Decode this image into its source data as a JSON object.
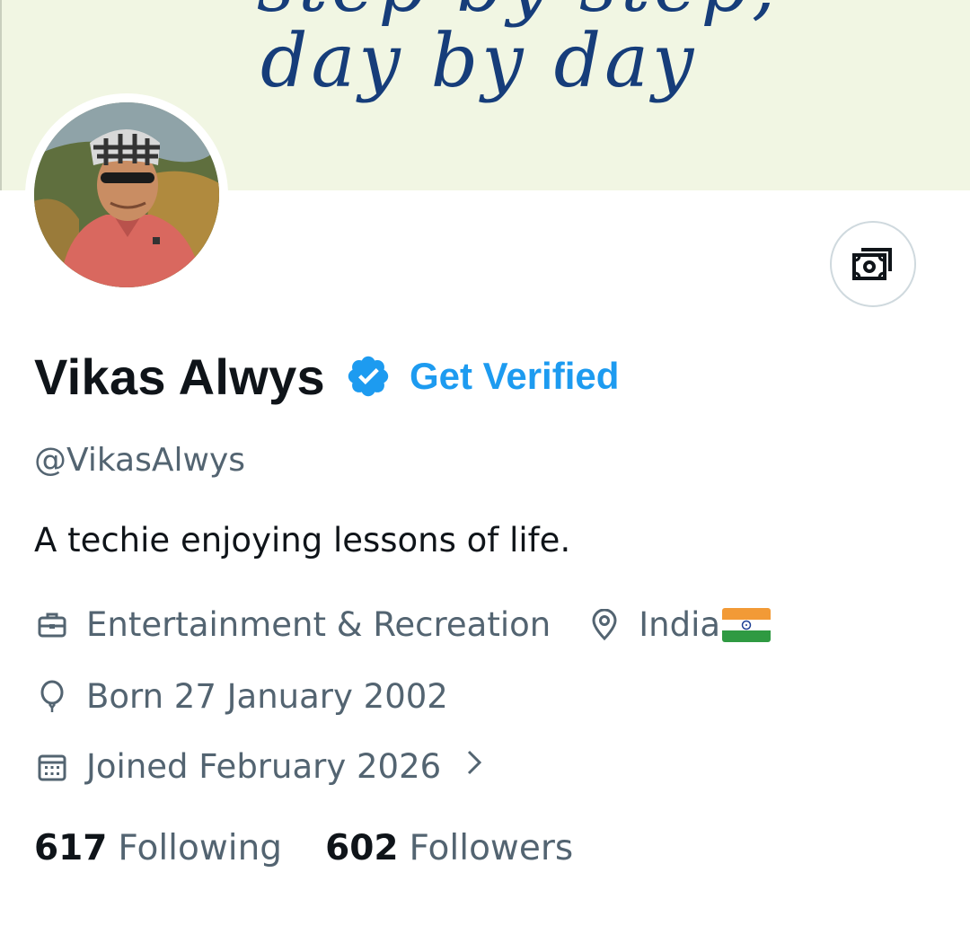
{
  "banner": {
    "text_top": "step by step,",
    "text_main": "day by day"
  },
  "profile": {
    "name": "Vikas Alwys",
    "get_verified_label": "Get Verified",
    "handle": "@VikasAlwys",
    "bio": "A techie enjoying lessons of life.",
    "category": "Entertainment & Recreation",
    "location": "India",
    "birthday": "Born 27 January 2002",
    "joined": "Joined February 2026",
    "following_count": "617",
    "following_label": "Following",
    "followers_count": "602",
    "followers_label": "Followers"
  },
  "icons": {
    "tip_button": "money-icon",
    "verified": "verified-badge-icon",
    "category": "briefcase-icon",
    "location": "location-pin-icon",
    "birthday": "balloon-icon",
    "joined": "calendar-icon",
    "joined_more": "chevron-right-icon",
    "flag": "india-flag-icon"
  },
  "colors": {
    "accent": "#1d9bf0",
    "text_primary": "#0f1419",
    "text_secondary": "#536471",
    "banner_bg": "#f1f6e3",
    "banner_text": "#163d7a"
  }
}
